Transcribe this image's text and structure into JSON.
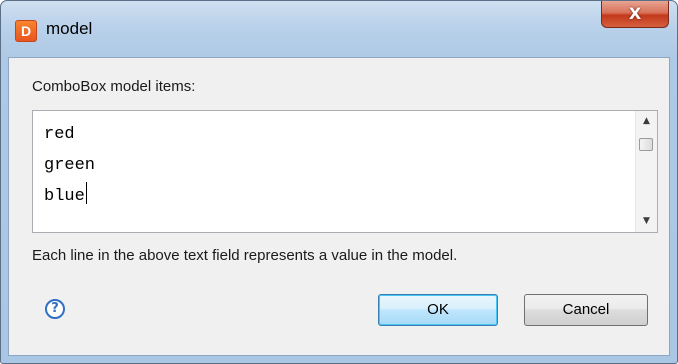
{
  "window": {
    "title": "model",
    "app_icon_glyph": "D",
    "app_icon": "app-logo-icon",
    "close_glyph": "X",
    "close_icon": "close-icon"
  },
  "content": {
    "field_label": "ComboBox model items:",
    "items": [
      "red",
      "green",
      "blue"
    ],
    "help_text": "Each line in the above text field represents a value in the model."
  },
  "scrollbar": {
    "up_glyph": "▲",
    "down_glyph": "▼"
  },
  "buttons": {
    "help_glyph": "?",
    "ok_label": "OK",
    "cancel_label": "Cancel"
  },
  "colors": {
    "titlebar": "#b9d1ea",
    "close_button": "#c2391c",
    "help_icon": "#2f6fc6",
    "default_button_border": "#3c7fb1"
  }
}
